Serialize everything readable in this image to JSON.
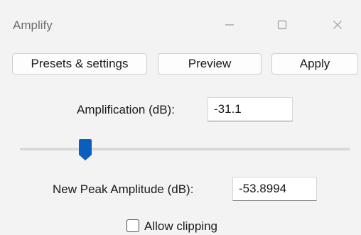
{
  "window": {
    "title": "Amplify",
    "minimize_icon": "minimize-icon",
    "maximize_icon": "maximize-icon",
    "close_icon": "close-icon"
  },
  "buttons": {
    "presets": "Presets & settings",
    "preview": "Preview",
    "apply": "Apply"
  },
  "amplification": {
    "label": "Amplification (dB):",
    "value": "-31.1"
  },
  "slider": {
    "value_fraction": 0.19
  },
  "peak": {
    "label": "New Peak Amplitude (dB):",
    "value": "-53.8994"
  },
  "clipping": {
    "label": "Allow clipping",
    "checked": false
  },
  "colors": {
    "accent": "#0a5fbe",
    "background": "#f3f3f3"
  }
}
